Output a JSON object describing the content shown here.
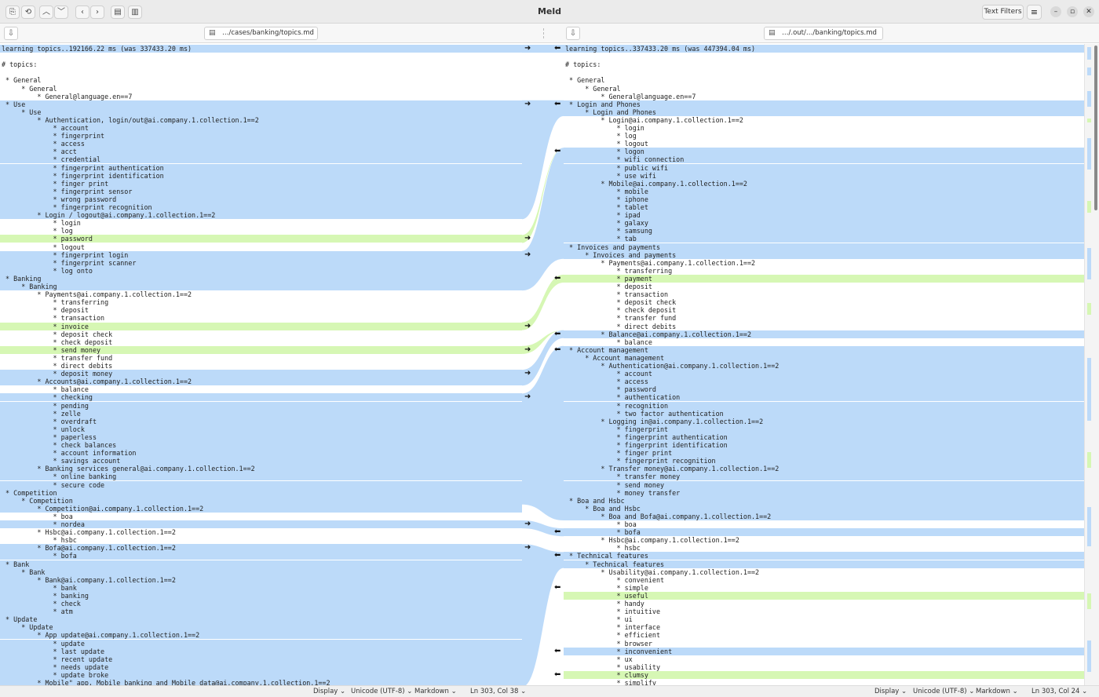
{
  "app": {
    "title": "Meld",
    "text_filters_label": "Text Filters",
    "menu_icon": "hamburger-icon",
    "window_controls": [
      "minimize-icon",
      "restore-icon",
      "close-icon"
    ]
  },
  "toolbar_icons": [
    "new-comparison-icon",
    "recent-icon",
    "previous-change-icon",
    "next-change-icon",
    "previous-conflict-icon",
    "next-conflict-icon",
    "save-icon",
    "delete-icon"
  ],
  "files": {
    "left_path": "…/cases/banking/topics.md",
    "right_path": "…/.out/…/banking/topics.md"
  },
  "colors": {
    "changed": "#bcdaf9",
    "inserted": "#d6f7b4",
    "highlight": "#8fc0f2"
  },
  "left_lines": [
    {
      "text": "learning topics..192166.22 ms (was 337433.20 ms)",
      "kind": "b"
    },
    {
      "text": "",
      "kind": ""
    },
    {
      "text": "# topics:",
      "kind": ""
    },
    {
      "text": "",
      "kind": ""
    },
    {
      "text": " * General",
      "kind": ""
    },
    {
      "text": "     * General",
      "kind": ""
    },
    {
      "text": "         * General@language.en==7",
      "kind": ""
    },
    {
      "text": " * Use",
      "kind": "b"
    },
    {
      "text": "     * Use",
      "kind": "b"
    },
    {
      "text": "         * Authentication, login/out@ai.company.1.collection.1==2",
      "kind": "b"
    },
    {
      "text": "             * account",
      "kind": "b"
    },
    {
      "text": "             * fingerprint",
      "kind": "b"
    },
    {
      "text": "             * access",
      "kind": "b"
    },
    {
      "text": "             * acct",
      "kind": "b"
    },
    {
      "text": "             * credential",
      "kind": "b"
    },
    {
      "text": "             * fingerprint authentication",
      "kind": "b"
    },
    {
      "text": "             * fingerprint identification",
      "kind": "b"
    },
    {
      "text": "             * finger print",
      "kind": "b"
    },
    {
      "text": "             * fingerprint sensor",
      "kind": "b"
    },
    {
      "text": "             * wrong password",
      "kind": "b"
    },
    {
      "text": "             * fingerprint recognition",
      "kind": "b"
    },
    {
      "text": "         * Login / logout@ai.company.1.collection.1==2",
      "kind": "b"
    },
    {
      "text": "             * login",
      "kind": ""
    },
    {
      "text": "             * log",
      "kind": ""
    },
    {
      "text": "             * password",
      "kind": "g"
    },
    {
      "text": "             * logout",
      "kind": ""
    },
    {
      "text": "             * fingerprint login",
      "kind": "b"
    },
    {
      "text": "             * fingerprint scanner",
      "kind": "b"
    },
    {
      "text": "             * log onto",
      "kind": "b"
    },
    {
      "text": " * Banking",
      "kind": "b"
    },
    {
      "text": "     * Banking",
      "kind": "b"
    },
    {
      "text": "         * Payments@ai.company.1.collection.1==2",
      "kind": ""
    },
    {
      "text": "             * transferring",
      "kind": ""
    },
    {
      "text": "             * deposit",
      "kind": ""
    },
    {
      "text": "             * transaction",
      "kind": ""
    },
    {
      "text": "             * invoice",
      "kind": "g"
    },
    {
      "text": "             * deposit check",
      "kind": ""
    },
    {
      "text": "             * check deposit",
      "kind": ""
    },
    {
      "text": "             * send money",
      "kind": "g"
    },
    {
      "text": "             * transfer fund",
      "kind": ""
    },
    {
      "text": "             * direct debits",
      "kind": ""
    },
    {
      "text": "             * deposit money",
      "kind": "b"
    },
    {
      "text": "         * Accounts@ai.company.1.collection.1==2",
      "kind": "b"
    },
    {
      "text": "             * balance",
      "kind": ""
    },
    {
      "text": "             * checking",
      "kind": "b"
    },
    {
      "text": "             * pending",
      "kind": "b"
    },
    {
      "text": "             * zelle",
      "kind": "b"
    },
    {
      "text": "             * overdraft",
      "kind": "b"
    },
    {
      "text": "             * unlock",
      "kind": "b"
    },
    {
      "text": "             * paperless",
      "kind": "b"
    },
    {
      "text": "             * check balances",
      "kind": "b"
    },
    {
      "text": "             * account information",
      "kind": "b"
    },
    {
      "text": "             * savings account",
      "kind": "b"
    },
    {
      "text": "         * Banking services general@ai.company.1.collection.1==2",
      "kind": "b"
    },
    {
      "text": "             * online banking",
      "kind": "b"
    },
    {
      "text": "             * secure code",
      "kind": "b"
    },
    {
      "text": " * Competition",
      "kind": "b"
    },
    {
      "text": "     * Competition",
      "kind": "b"
    },
    {
      "text": "         * Competition@ai.company.1.collection.1==2",
      "kind": "b"
    },
    {
      "text": "             * boa",
      "kind": ""
    },
    {
      "text": "             * nordea",
      "kind": "b"
    },
    {
      "text": "         * Hsbc@ai.company.1.collection.1==2",
      "kind": ""
    },
    {
      "text": "             * hsbc",
      "kind": ""
    },
    {
      "text": "         * Bofa@ai.company.1.collection.1==2",
      "kind": "b"
    },
    {
      "text": "             * bofa",
      "kind": "b"
    },
    {
      "text": " * Bank",
      "kind": "b"
    },
    {
      "text": "     * Bank",
      "kind": "b"
    },
    {
      "text": "         * Bank@ai.company.1.collection.1==2",
      "kind": "b"
    },
    {
      "text": "             * bank",
      "kind": "b"
    },
    {
      "text": "             * banking",
      "kind": "b"
    },
    {
      "text": "             * check",
      "kind": "b"
    },
    {
      "text": "             * atm",
      "kind": "b"
    },
    {
      "text": " * Update",
      "kind": "b"
    },
    {
      "text": "     * Update",
      "kind": "b"
    },
    {
      "text": "         * App update@ai.company.1.collection.1==2",
      "kind": "b"
    },
    {
      "text": "             * update",
      "kind": "b"
    },
    {
      "text": "             * last update",
      "kind": "b"
    },
    {
      "text": "             * recent update",
      "kind": "b"
    },
    {
      "text": "             * needs update",
      "kind": "b"
    },
    {
      "text": "             * update broke",
      "kind": "b"
    },
    {
      "text": "         * Mobile\" app, Mobile banking and Mobile data@ai.company.1.collection.1==2",
      "kind": "b"
    }
  ],
  "right_lines": [
    {
      "text": "learning topics..337433.20 ms (was 447394.04 ms)",
      "kind": "b"
    },
    {
      "text": "",
      "kind": ""
    },
    {
      "text": "# topics:",
      "kind": ""
    },
    {
      "text": "",
      "kind": ""
    },
    {
      "text": " * General",
      "kind": ""
    },
    {
      "text": "     * General",
      "kind": ""
    },
    {
      "text": "         * General@language.en==7",
      "kind": ""
    },
    {
      "text": " * Login and Phones",
      "kind": "b"
    },
    {
      "text": "     * Login and Phones",
      "kind": "b"
    },
    {
      "text": "         * Login@ai.company.1.collection.1==2",
      "kind": ""
    },
    {
      "text": "             * login",
      "kind": ""
    },
    {
      "text": "             * log",
      "kind": ""
    },
    {
      "text": "             * logout",
      "kind": ""
    },
    {
      "text": "             * logon",
      "kind": "b"
    },
    {
      "text": "             * wifi connection",
      "kind": "b"
    },
    {
      "text": "             * public wifi",
      "kind": "b"
    },
    {
      "text": "             * use wifi",
      "kind": "b"
    },
    {
      "text": "         * Mobile@ai.company.1.collection.1==2",
      "kind": "b"
    },
    {
      "text": "             * mobile",
      "kind": "b"
    },
    {
      "text": "             * iphone",
      "kind": "b"
    },
    {
      "text": "             * tablet",
      "kind": "b"
    },
    {
      "text": "             * ipad",
      "kind": "b"
    },
    {
      "text": "             * galaxy",
      "kind": "b"
    },
    {
      "text": "             * samsung",
      "kind": "b"
    },
    {
      "text": "             * tab",
      "kind": "b"
    },
    {
      "text": " * Invoices and payments",
      "kind": "b"
    },
    {
      "text": "     * Invoices and payments",
      "kind": "b"
    },
    {
      "text": "         * Payments@ai.company.1.collection.1==2",
      "kind": ""
    },
    {
      "text": "             * transferring",
      "kind": ""
    },
    {
      "text": "             * payment",
      "kind": "g"
    },
    {
      "text": "             * deposit",
      "kind": ""
    },
    {
      "text": "             * transaction",
      "kind": ""
    },
    {
      "text": "             * deposit check",
      "kind": ""
    },
    {
      "text": "             * check deposit",
      "kind": ""
    },
    {
      "text": "             * transfer fund",
      "kind": ""
    },
    {
      "text": "             * direct debits",
      "kind": ""
    },
    {
      "text": "         * Balance@ai.company.1.collection.1==2",
      "kind": "b"
    },
    {
      "text": "             * balance",
      "kind": ""
    },
    {
      "text": " * Account management",
      "kind": "b"
    },
    {
      "text": "     * Account management",
      "kind": "b"
    },
    {
      "text": "         * Authentication@ai.company.1.collection.1==2",
      "kind": "b"
    },
    {
      "text": "             * account",
      "kind": "b"
    },
    {
      "text": "             * access",
      "kind": "b"
    },
    {
      "text": "             * password",
      "kind": "b"
    },
    {
      "text": "             * authentication",
      "kind": "b"
    },
    {
      "text": "             * recognition",
      "kind": "b"
    },
    {
      "text": "             * two factor authentication",
      "kind": "b"
    },
    {
      "text": "         * Logging in@ai.company.1.collection.1==2",
      "kind": "b"
    },
    {
      "text": "             * fingerprint",
      "kind": "b"
    },
    {
      "text": "             * fingerprint authentication",
      "kind": "b"
    },
    {
      "text": "             * fingerprint identification",
      "kind": "b"
    },
    {
      "text": "             * finger print",
      "kind": "b"
    },
    {
      "text": "             * fingerprint recognition",
      "kind": "b"
    },
    {
      "text": "         * Transfer money@ai.company.1.collection.1==2",
      "kind": "b"
    },
    {
      "text": "             * transfer money",
      "kind": "b"
    },
    {
      "text": "             * send money",
      "kind": "b"
    },
    {
      "text": "             * money transfer",
      "kind": "b"
    },
    {
      "text": " * Boa and Hsbc",
      "kind": "b"
    },
    {
      "text": "     * Boa and Hsbc",
      "kind": "b"
    },
    {
      "text": "         * Boa and Bofa@ai.company.1.collection.1==2",
      "kind": "b"
    },
    {
      "text": "             * boa",
      "kind": ""
    },
    {
      "text": "             * bofa",
      "kind": "b"
    },
    {
      "text": "         * Hsbc@ai.company.1.collection.1==2",
      "kind": ""
    },
    {
      "text": "             * hsbc",
      "kind": ""
    },
    {
      "text": " * Technical features",
      "kind": "b"
    },
    {
      "text": "     * Technical features",
      "kind": "b"
    },
    {
      "text": "         * Usability@ai.company.1.collection.1==2",
      "kind": ""
    },
    {
      "text": "             * convenient",
      "kind": ""
    },
    {
      "text": "             * simple",
      "kind": ""
    },
    {
      "text": "             * useful",
      "kind": "g"
    },
    {
      "text": "             * handy",
      "kind": ""
    },
    {
      "text": "             * intuitive",
      "kind": ""
    },
    {
      "text": "             * ui",
      "kind": ""
    },
    {
      "text": "             * interface",
      "kind": ""
    },
    {
      "text": "             * efficient",
      "kind": ""
    },
    {
      "text": "             * browser",
      "kind": ""
    },
    {
      "text": "             * inconvenient",
      "kind": "b"
    },
    {
      "text": "             * ux",
      "kind": ""
    },
    {
      "text": "             * usability",
      "kind": ""
    },
    {
      "text": "             * clumsy",
      "kind": "g"
    },
    {
      "text": "             * simplify",
      "kind": ""
    }
  ],
  "status_left": {
    "display": "Display",
    "encoding": "Unicode (UTF-8)",
    "syntax": "Markdown",
    "position": "Ln 303, Col 38"
  },
  "status_right": {
    "display": "Display",
    "encoding": "Unicode (UTF-8)",
    "syntax": "Markdown",
    "position": "Ln 303, Col 24"
  }
}
